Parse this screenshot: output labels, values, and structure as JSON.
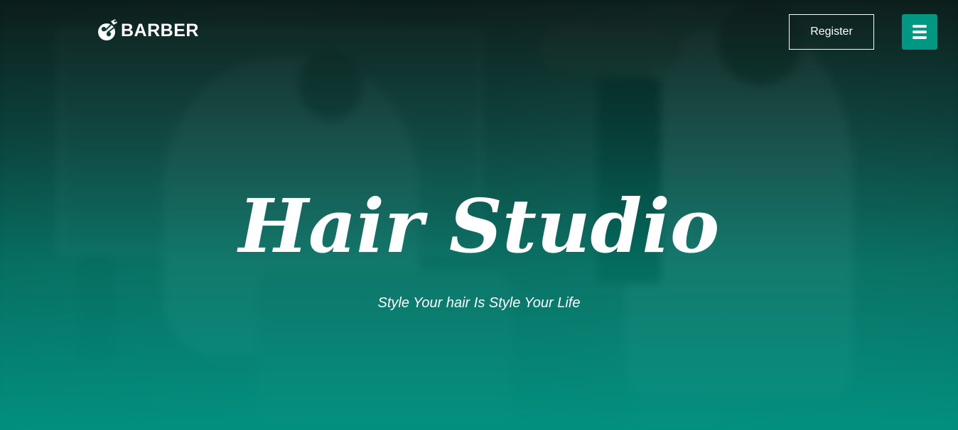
{
  "navbar": {
    "brand": {
      "text": "BARBER",
      "icon": "barber-scissors-logo-icon"
    },
    "register_label": "Register",
    "menu_icon": "hamburger-menu-icon"
  },
  "hero": {
    "title": "Hair Studio",
    "subtitle": "Style Your hair Is Style Your Life"
  },
  "colors": {
    "accent": "#009882",
    "overlay_top": "#0a1c1a",
    "overlay_bottom": "#00947f",
    "text": "#ffffff"
  }
}
